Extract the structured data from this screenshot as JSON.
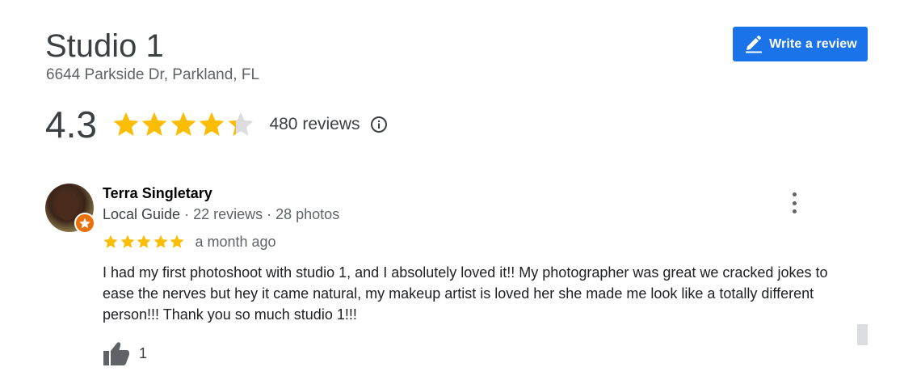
{
  "place": {
    "name": "Studio 1",
    "address": "6644 Parkside Dr, Parkland, FL"
  },
  "actions": {
    "write_review_label": "Write a review"
  },
  "summary": {
    "rating": "4.3",
    "rating_value": 4.3,
    "max_rating": 5,
    "review_count": "480 reviews",
    "star_color": "#fbbc04",
    "empty_star_color": "#dadce0"
  },
  "review": {
    "reviewer_name": "Terra Singletary",
    "reviewer_level": "Local Guide",
    "separator": " · ",
    "reviewer_reviews": "22 reviews",
    "reviewer_photos": "28 photos",
    "stars": 5,
    "date": "a month ago",
    "text": "I had my first photoshoot with studio 1, and I absolutely loved it!! My photographer was great we cracked jokes to ease the nerves but hey it came natural, my makeup artist is loved her she made me look like a totally different person!!! Thank you so much studio 1!!!",
    "likes": "1"
  },
  "colors": {
    "accent": "#1a73e8",
    "guide_badge": "#e8710a"
  }
}
